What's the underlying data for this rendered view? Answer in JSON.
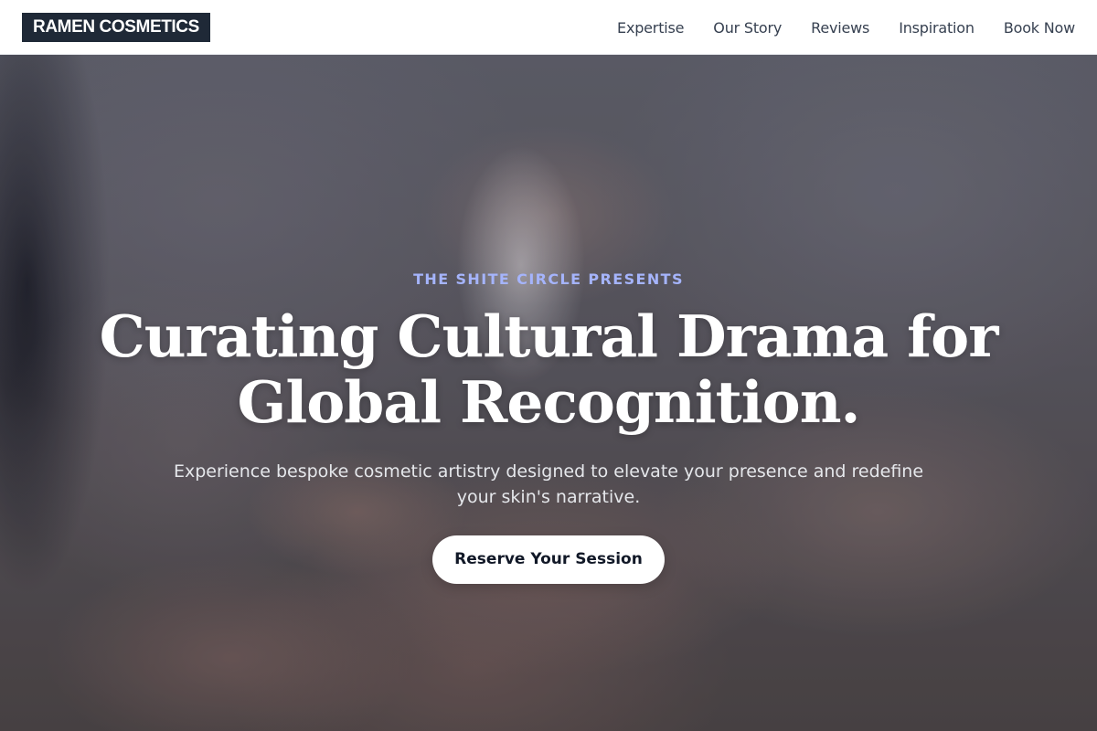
{
  "brand": {
    "logo_text": "RAMEN COSMETICS"
  },
  "nav": {
    "items": [
      {
        "label": "Expertise"
      },
      {
        "label": "Our Story"
      },
      {
        "label": "Reviews"
      },
      {
        "label": "Inspiration"
      },
      {
        "label": "Book Now"
      }
    ]
  },
  "hero": {
    "eyebrow": "THE SHITE CIRCLE PRESENTS",
    "headline": "Curating Cultural Drama for Global Recognition.",
    "subtitle": "Experience bespoke cosmetic artistry designed to elevate your presence and redefine your skin's narrative.",
    "cta_label": "Reserve Your Session"
  },
  "colors": {
    "header_bg": "#ffffff",
    "logo_bg": "#1f2937",
    "eyebrow": "#a5b4fc",
    "headline": "#ffffff",
    "cta_bg": "#ffffff",
    "cta_text": "#111827"
  }
}
